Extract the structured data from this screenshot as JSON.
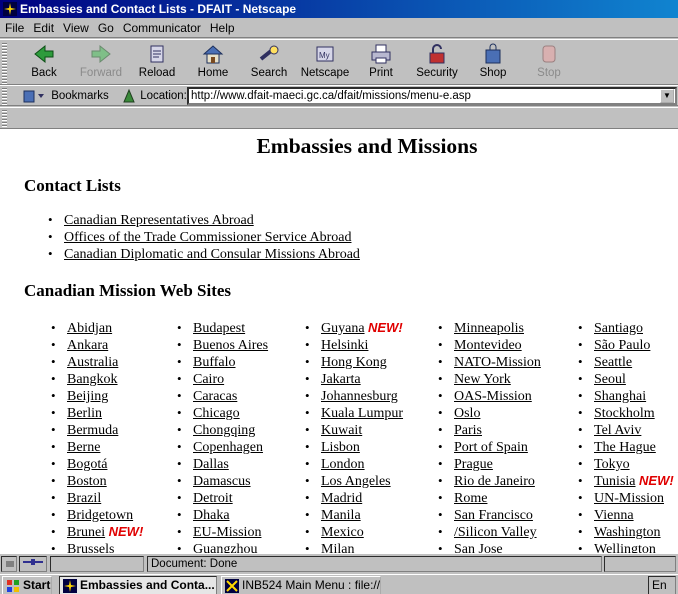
{
  "window": {
    "title": "Embassies and Contact Lists - DFAIT - Netscape"
  },
  "menu": [
    "File",
    "Edit",
    "View",
    "Go",
    "Communicator",
    "Help"
  ],
  "toolbar": {
    "back": "Back",
    "forward": "Forward",
    "reload": "Reload",
    "home": "Home",
    "search": "Search",
    "netscape": "Netscape",
    "print": "Print",
    "security": "Security",
    "shop": "Shop",
    "stop": "Stop"
  },
  "location": {
    "bookmarks_label": "Bookmarks",
    "label": "Location:",
    "url": "http://www.dfait-maeci.gc.ca/dfait/missions/menu-e.asp"
  },
  "page": {
    "title": "Embassies and Missions",
    "contact_heading": "Contact Lists",
    "contact_links": [
      "Canadian Representatives Abroad",
      "Offices of the Trade Commissioner Service Abroad",
      "Canadian Diplomatic and Consular Missions Abroad"
    ],
    "missions_heading": "Canadian Mission Web Sites",
    "new_badge": "NEW!",
    "col1": [
      "Abidjan",
      "Ankara",
      "Australia",
      "Bangkok",
      "Beijing",
      "Berlin",
      "Bermuda",
      "Berne",
      "Bogotá",
      "Boston",
      "Brazil",
      "Bridgetown",
      "Brunei",
      "Brussels"
    ],
    "col2": [
      "Budapest",
      "Buenos Aires",
      "Buffalo",
      "Cairo",
      "Caracas",
      "Chicago",
      "Chongqing",
      "Copenhagen",
      "Dallas",
      "Damascus",
      "Detroit",
      "Dhaka",
      "EU-Mission",
      "Guangzhou"
    ],
    "col3": [
      "Guyana",
      "Helsinki",
      "Hong Kong",
      "Jakarta",
      "Johannesburg",
      "Kuala Lumpur",
      "Kuwait",
      "Lisbon",
      "London",
      "Los Angeles",
      "Madrid",
      "Manila",
      "Mexico",
      "Milan"
    ],
    "col4": [
      "Minneapolis",
      "Montevideo",
      "NATO-Mission",
      "New York",
      "OAS-Mission",
      "Oslo",
      "Paris",
      "Port of Spain",
      "Prague",
      "Rio de Janeiro",
      "Rome",
      "San Francisco",
      "/Silicon Valley",
      "San Jose"
    ],
    "col5": [
      "Santiago",
      "São Paulo",
      "Seattle",
      "Seoul",
      "Shanghai",
      "Stockholm",
      "Tel Aviv",
      "The Hague",
      "Tokyo",
      "Tunisia",
      "UN-Mission",
      "Vienna",
      "Washington",
      "Wellington"
    ]
  },
  "status": {
    "text": "Document: Done"
  },
  "taskbar": {
    "start": "Start",
    "task1": "Embassies and Conta...",
    "task2": "INB524 Main Menu : file://...",
    "lang": "En"
  }
}
